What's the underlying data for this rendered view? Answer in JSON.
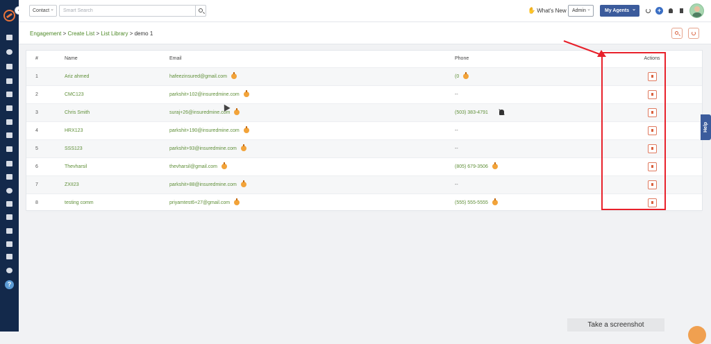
{
  "topbar": {
    "contact_select": "Contact",
    "search_placeholder": "Smart Search",
    "whats_new": "What's New",
    "admin_select": "Admin",
    "my_agents": "My Agents"
  },
  "breadcrumb": {
    "items": [
      "Engagement",
      "Create List",
      "List Library",
      "demo 1"
    ],
    "separator": ">"
  },
  "table": {
    "headers": [
      "#",
      "Name",
      "Email",
      "Phone",
      "Actions"
    ],
    "rows": [
      {
        "idx": "1",
        "name": "Ariz ahmed",
        "email": "hafeezinsured@gmail.com",
        "phone": "(0",
        "phone_icon": "alert-icon"
      },
      {
        "idx": "2",
        "name": "CMC123",
        "email": "parkshit+102@insuredmine.com",
        "phone": "--",
        "phone_icon": ""
      },
      {
        "idx": "3",
        "name": "Chris Smith",
        "email": "suraj+26@insuredmine.com",
        "phone": "(503) 383-4791",
        "phone_icon": "mute-icon"
      },
      {
        "idx": "4",
        "name": "HRX123",
        "email": "parkshit+190@insuredmine.com",
        "phone": "--",
        "phone_icon": ""
      },
      {
        "idx": "5",
        "name": "SSS123",
        "email": "parkshit+93@insuredmine.com",
        "phone": "--",
        "phone_icon": ""
      },
      {
        "idx": "6",
        "name": "Thevharsil",
        "email": "thevharsil@gmail.com",
        "phone": "(805) 679-3506",
        "phone_icon": "alert-icon"
      },
      {
        "idx": "7",
        "name": "ZXII23",
        "email": "parkshit+88@insuredmine.com",
        "phone": "--",
        "phone_icon": ""
      },
      {
        "idx": "8",
        "name": "testing comm",
        "email": "priyamtest6+27@gmail.com",
        "phone": "(555) 555-5555",
        "phone_icon": "alert-icon"
      }
    ]
  },
  "help_tab": "Help",
  "screenshot_bar": "Take a screenshot",
  "colors": {
    "sidebar": "#13294b",
    "accent_green": "#5f8f38",
    "brand_blue": "#3b5b9c",
    "highlight_red": "#e8202a",
    "action_orange": "#d9613e"
  }
}
